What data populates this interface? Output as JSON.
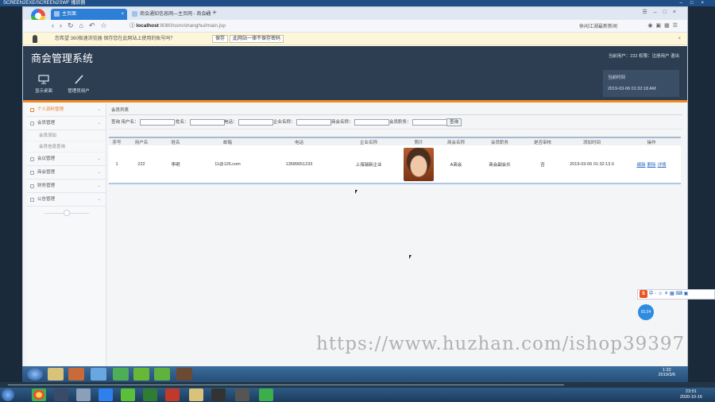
{
  "recorder": {
    "title": "SCREEN2EXE/SCREEN2SWF 播放器"
  },
  "browser": {
    "tabs": [
      {
        "label": "主页面",
        "active": true
      },
      {
        "label": "商会通知信息网—主页网 - 商会通知信息",
        "active": false
      }
    ],
    "address": {
      "host": "localhost",
      "path": ":8080/ssm/shanghui/main.jsp"
    },
    "toolbar_right": "休闲江湖最新新闻"
  },
  "notice": {
    "message": "您希望 360极速浏览器 保存您在此网站上使用的账号吗？",
    "save_label": "保存",
    "never_label": "此网站一律不保存密码"
  },
  "app": {
    "title": "商会管理系统",
    "user_info": "当前用户：222 权限：注册用户 退出",
    "header_buttons": [
      {
        "label": "显示桌面",
        "icon": "monitor-icon"
      },
      {
        "label": "管理员用户",
        "icon": "pencil-icon"
      }
    ],
    "time": {
      "label": "当前时间",
      "value": "2019-03-06 01:32:18 AM"
    },
    "accent": "#f08a24",
    "sidebar": {
      "items": [
        {
          "label": "个人资料管理",
          "active": true
        },
        {
          "label": "会员管理",
          "active": false,
          "children": [
            "会员添加",
            "会员信息查询"
          ]
        },
        {
          "label": "会议管理",
          "active": false
        },
        {
          "label": "商会管理",
          "active": false
        },
        {
          "label": "财务管理",
          "active": false
        },
        {
          "label": "公告管理",
          "active": false
        }
      ]
    },
    "panel_title": "会员列表",
    "search": {
      "fields": [
        "查询 用户名：",
        "姓名：",
        "电话：",
        "企业名称：",
        "商会名称：",
        "会员职务："
      ],
      "button": "查询"
    },
    "table": {
      "headers": [
        "序号",
        "用户名",
        "姓名",
        "邮箱",
        "电话",
        "企业名称",
        "照片",
        "商会名称",
        "会员职务",
        "是否审核",
        "添加时间",
        "操作"
      ],
      "rows": [
        {
          "no": "1",
          "username": "222",
          "name": "李明",
          "email": "11@126.com",
          "phone": "13589651233",
          "company": "上海瑞新企业",
          "chamber": "A商会",
          "position": "商会副会长",
          "audited": "否",
          "added": "2019-03-06 01:32:13.0",
          "ops": [
            "编辑",
            "删除",
            "详情"
          ]
        }
      ]
    }
  },
  "ime": {
    "label": "中"
  },
  "timer": "01:24",
  "watermark": "https://www.huzhan.com/ishop39397",
  "inner_clock": {
    "time": "1:32",
    "date": "2019/3/6"
  },
  "clock": {
    "time": "23:51",
    "date": "2020-10-16"
  }
}
